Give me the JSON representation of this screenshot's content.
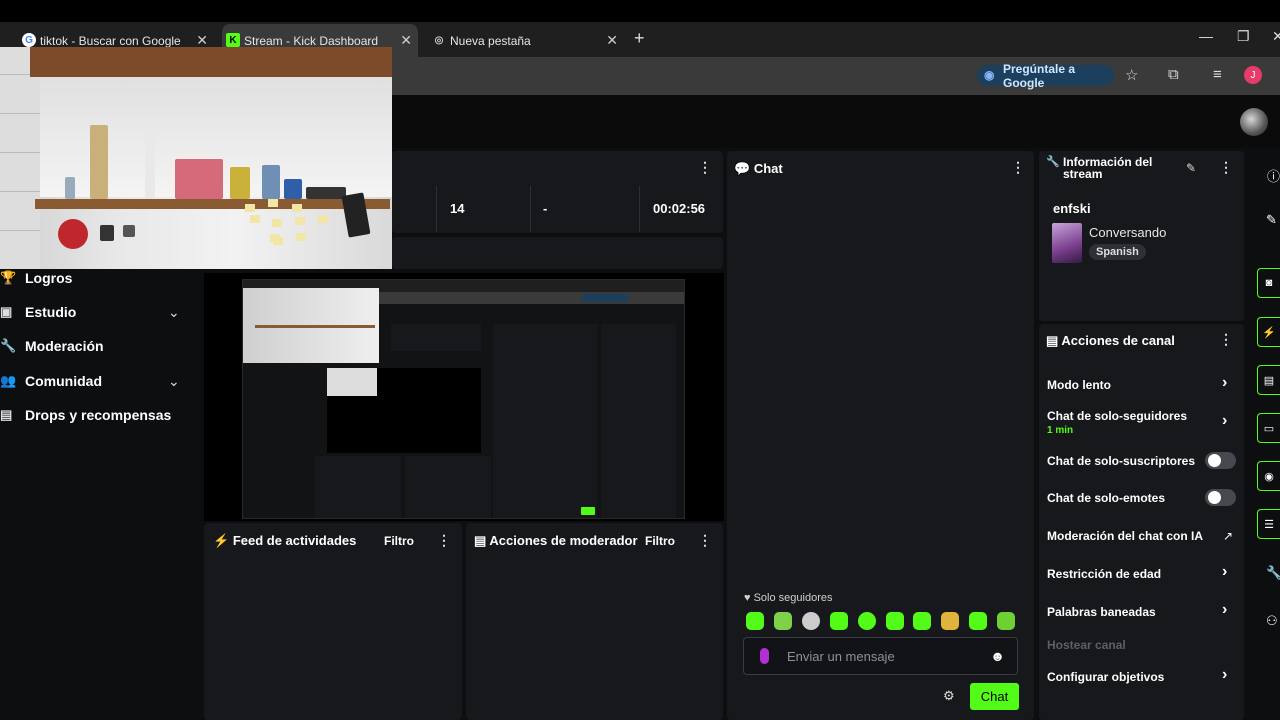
{
  "browser": {
    "tabs": [
      {
        "title": "tiktok - Buscar con Google",
        "favicon": "G"
      },
      {
        "title": "Stream - Kick Dashboard",
        "favicon": "K"
      },
      {
        "title": "Nueva pestaña",
        "favicon": "◎"
      }
    ],
    "ask_google": "Pregúntale a Google",
    "profile_initial": "J"
  },
  "stats": {
    "followers_count": "14",
    "dash": "-",
    "uptime": "00:02:56"
  },
  "sidebar": {
    "items": [
      {
        "label": "Logros",
        "icon": "trophy-icon"
      },
      {
        "label": "Estudio",
        "icon": "studio-icon"
      },
      {
        "label": "Moderación",
        "icon": "wrench-icon"
      },
      {
        "label": "Comunidad",
        "icon": "community-icon"
      },
      {
        "label": "Drops y recompensas",
        "icon": "drops-icon"
      }
    ]
  },
  "panels": {
    "activity_feed": {
      "title": "Feed de actividades",
      "filter": "Filtro"
    },
    "mod_actions": {
      "title": "Acciones de moderador",
      "filter": "Filtro"
    },
    "chat": {
      "title": "Chat",
      "mode_notice": "Solo seguidores",
      "placeholder": "Enviar un mensaje",
      "send_label": "Chat"
    },
    "stream_info": {
      "title": "Información del stream",
      "username": "enfski",
      "category": "Conversando",
      "language": "Spanish"
    },
    "channel_actions": {
      "title": "Acciones de canal",
      "items": [
        {
          "label": "Modo lento",
          "control": "arrow"
        },
        {
          "label": "Chat de solo-seguidores",
          "sub": "1 min",
          "control": "arrow"
        },
        {
          "label": "Chat de solo-suscriptores",
          "control": "toggle"
        },
        {
          "label": "Chat de solo-emotes",
          "control": "toggle"
        },
        {
          "label": "Moderación del chat con IA",
          "control": "external"
        },
        {
          "label": "Restricción de edad",
          "control": "arrow"
        },
        {
          "label": "Palabras baneadas",
          "control": "arrow"
        },
        {
          "label": "Hostear canal",
          "control": "none",
          "disabled": true
        },
        {
          "label": "Configurar objetivos",
          "control": "arrow"
        }
      ]
    }
  },
  "colors": {
    "accent": "#53fc18",
    "panel": "#17181b",
    "background": "#0d0e10"
  }
}
